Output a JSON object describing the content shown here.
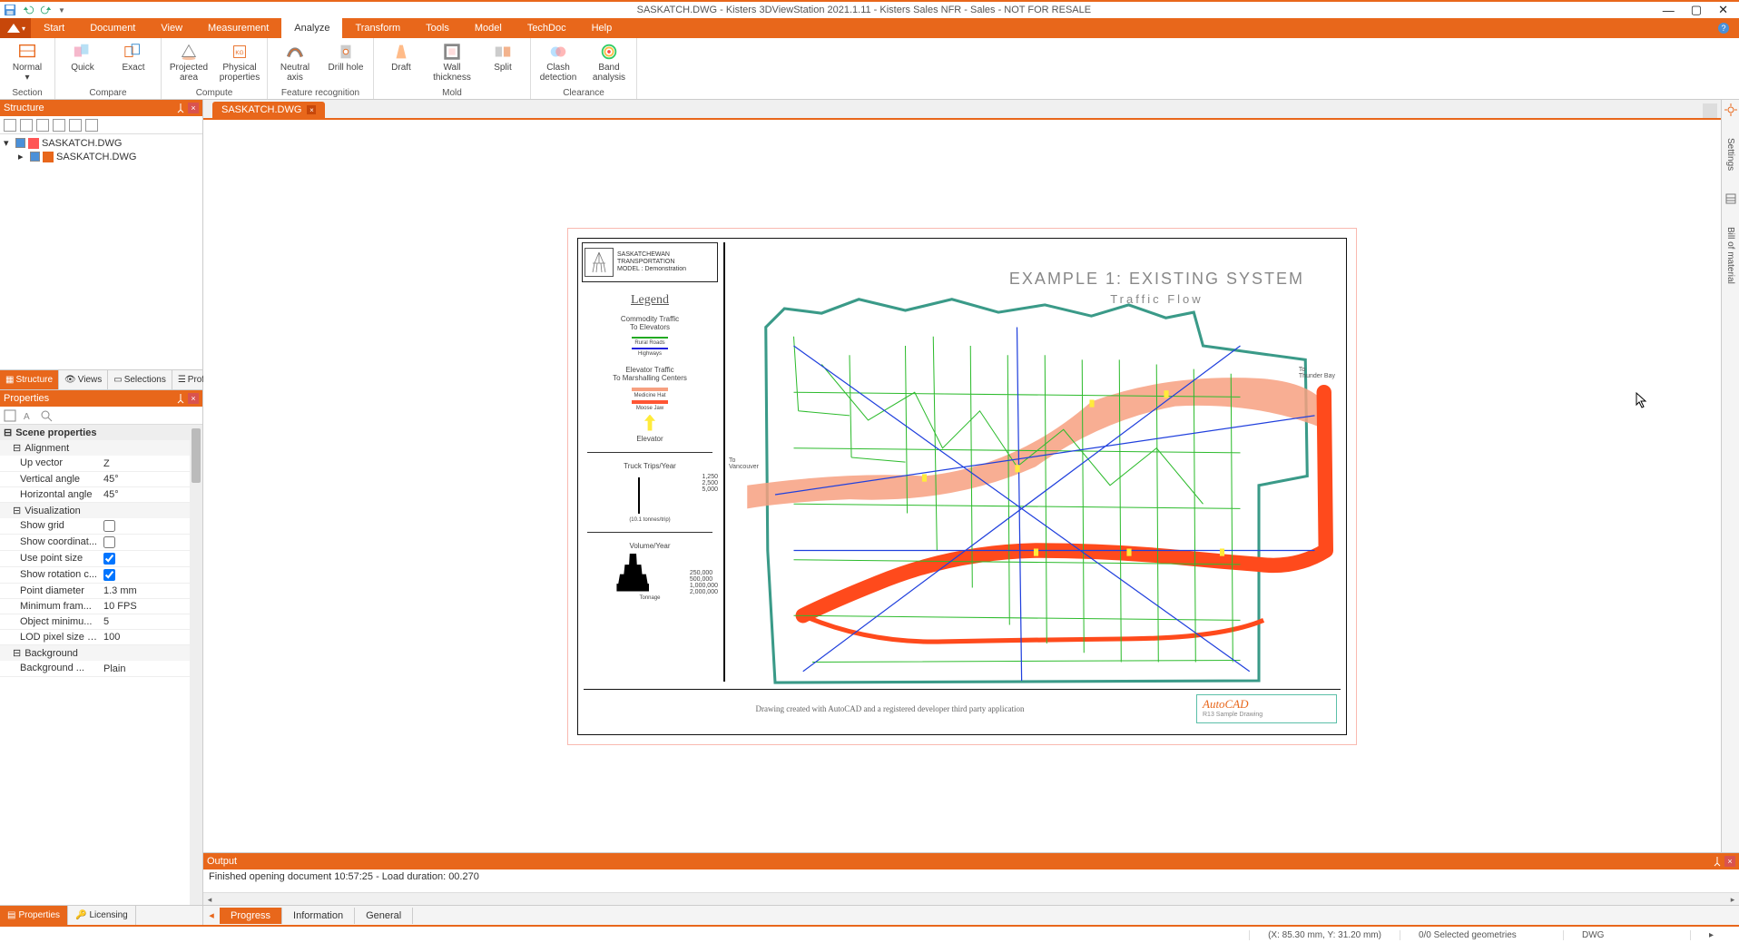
{
  "title": "SASKATCH.DWG - Kisters 3DViewStation 2021.1.11 - Kisters Sales NFR - Sales - NOT FOR RESALE",
  "ribbon_tabs": [
    "Start",
    "Document",
    "View",
    "Measurement",
    "Analyze",
    "Transform",
    "Tools",
    "Model",
    "TechDoc",
    "Help"
  ],
  "ribbon_active": "Analyze",
  "ribbon": {
    "section": {
      "label": "Section",
      "items": [
        {
          "l": "Normal"
        },
        {
          "l": "Quick"
        },
        {
          "l": "Exact"
        }
      ]
    },
    "compare": {
      "label": "Compare"
    },
    "compute": {
      "label": "Compute",
      "items": [
        {
          "l": "Projected area"
        },
        {
          "l": "Physical properties"
        }
      ]
    },
    "feature": {
      "label": "Feature recognition",
      "items": [
        {
          "l": "Neutral axis"
        },
        {
          "l": "Drill hole"
        }
      ]
    },
    "mold": {
      "label": "Mold",
      "items": [
        {
          "l": "Draft"
        },
        {
          "l": "Wall thickness"
        },
        {
          "l": "Split"
        }
      ]
    },
    "clearance": {
      "label": "Clearance",
      "items": [
        {
          "l": "Clash detection"
        },
        {
          "l": "Band analysis"
        }
      ]
    }
  },
  "structure": {
    "title": "Structure",
    "tree": [
      {
        "name": "SASKATCH.DWG",
        "level": 0
      },
      {
        "name": "SASKATCH.DWG",
        "level": 1
      }
    ]
  },
  "left_tabs": [
    "Structure",
    "Views",
    "Selections",
    "Profiles"
  ],
  "properties": {
    "title": "Properties",
    "sections": {
      "scene": "Scene properties",
      "alignment": "Alignment",
      "visualization": "Visualization",
      "background": "Background"
    },
    "rows": {
      "up_vector": {
        "n": "Up vector",
        "v": "Z"
      },
      "vertical_angle": {
        "n": "Vertical angle",
        "v": "45°"
      },
      "horizontal_angle": {
        "n": "Horizontal angle",
        "v": "45°"
      },
      "show_grid": {
        "n": "Show grid",
        "v": false
      },
      "show_coord": {
        "n": "Show coordinat...",
        "v": false
      },
      "use_point": {
        "n": "Use point size",
        "v": true
      },
      "show_rot": {
        "n": "Show rotation c...",
        "v": true
      },
      "point_diam": {
        "n": "Point diameter",
        "v": "1.3 mm"
      },
      "min_fram": {
        "n": "Minimum fram...",
        "v": "10 FPS"
      },
      "obj_min": {
        "n": "Object minimu...",
        "v": "5"
      },
      "lod": {
        "n": "LOD pixel size t...",
        "v": "100"
      },
      "bg": {
        "n": "Background ...",
        "v": "Plain"
      }
    }
  },
  "bottom_left_tabs": [
    "Properties",
    "Licensing"
  ],
  "doc_tab": "SASKATCH.DWG",
  "drawing": {
    "header_l1": "SASKATCHEWAN",
    "header_l2": "TRANSPORTATION",
    "header_l3": "MODEL : Demonstration",
    "legend_title": "Legend",
    "commodity": "Commodity Traffic\nTo Elevators",
    "rural": "Rural Roads",
    "highways": "Highways",
    "elev_traffic": "Elevator Traffic\nTo Marshalling Centers",
    "medhat": "Medicine Hat",
    "moose": "Moose Jaw",
    "elevator": "Elevator",
    "truck": "Truck Trips/Year",
    "t1": "1,250",
    "t2": "2,500",
    "t3": "5,000",
    "tnote": "(10.1 tonnes/trip)",
    "volume": "Volume/Year",
    "v1": "250,000",
    "v2": "500,000",
    "v3": "1,000,000",
    "v4": "2,000,000",
    "tonnage": "Tonnage",
    "map_title": "EXAMPLE 1: EXISTING SYSTEM",
    "map_sub": "Traffic Flow",
    "footer": "Drawing created with AutoCAD and a registered developer third party application",
    "autocad": "AutoCAD",
    "autocad_sub": "R13 Sample Drawing",
    "to_vanc": "To\nVancouver",
    "to_thunder": "To\nThunder Bay"
  },
  "right_rail": {
    "settings": "Settings",
    "bom": "Bill of material"
  },
  "output": {
    "title": "Output",
    "msg": "Finished opening document 10:57:25 - Load duration: 00.270"
  },
  "bottom_tabs": [
    "Progress",
    "Information",
    "General"
  ],
  "status": {
    "coords": "(X: 85.30 mm, Y: 31.20 mm)",
    "sel": "0/0 Selected geometries",
    "fmt": "DWG"
  }
}
